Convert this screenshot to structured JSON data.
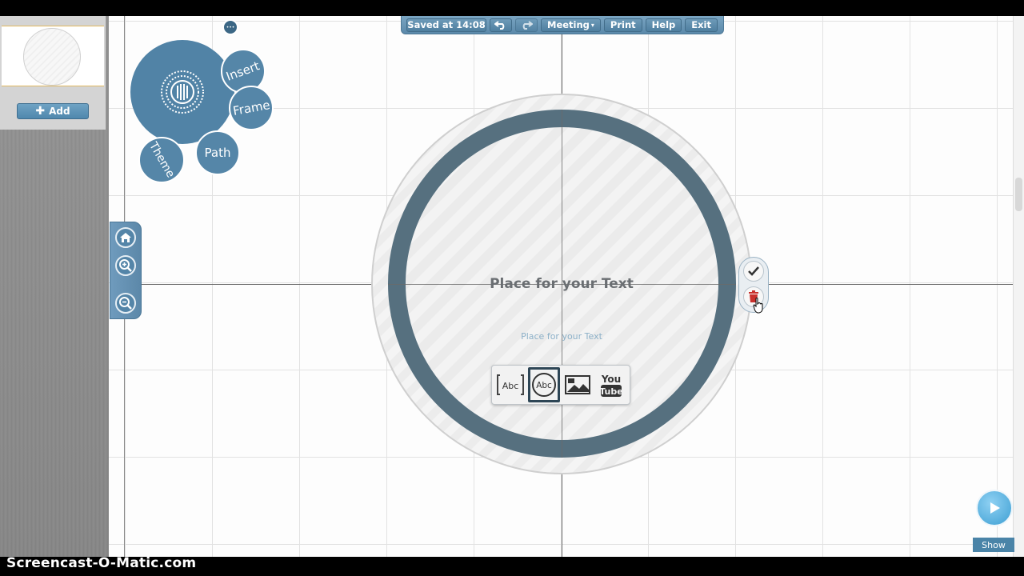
{
  "toolbar": {
    "saved": "Saved at 14:08",
    "meeting": "Meeting",
    "print": "Print",
    "help": "Help",
    "exit": "Exit",
    "undo_icon": "undo-icon",
    "redo_icon": "redo-icon"
  },
  "sidebar": {
    "add_label": "Add",
    "add_icon": "plus-icon"
  },
  "bubble_menu": {
    "insert": "Insert",
    "frame": "Frame",
    "path": "Path",
    "theme": "Theme",
    "mini": "•••"
  },
  "nav": {
    "home_icon": "home-icon",
    "zoom_in_icon": "zoom-in-icon",
    "zoom_out_icon": "zoom-out-icon"
  },
  "frame": {
    "title": "Place for your Text",
    "subtitle": "Place for your Text",
    "ring_color": "#56707f"
  },
  "insert_chooser": {
    "text_box": "Abc",
    "text_circle": "Abc",
    "youtube_top": "You",
    "youtube_bottom": "Tube",
    "image_icon": "image-icon"
  },
  "actions": {
    "confirm_icon": "check-icon",
    "delete_icon": "trash-icon"
  },
  "show": {
    "label": "Show"
  },
  "watermark": "Screencast-O-Matic.com",
  "colors": {
    "accent": "#5586a8",
    "show_button": "#3e9fd3",
    "delete_red": "#c9302c"
  }
}
